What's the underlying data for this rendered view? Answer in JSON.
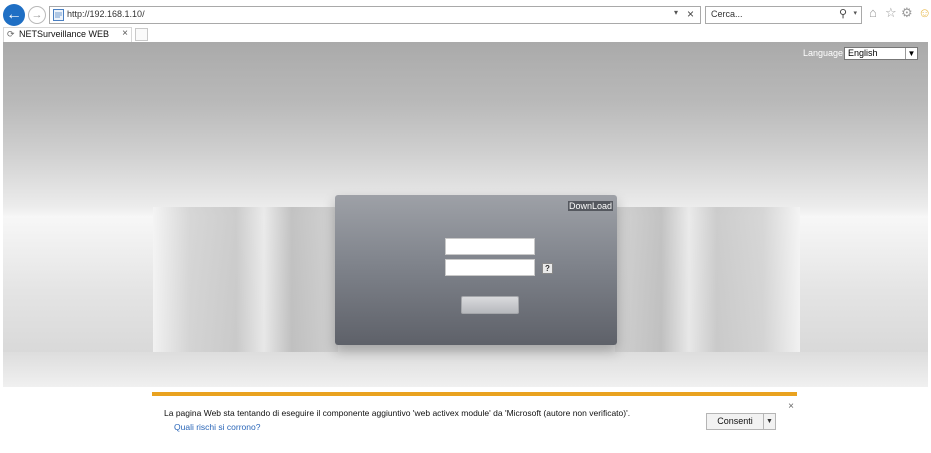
{
  "browser": {
    "address": "http://192.168.1.10/",
    "search_placeholder": "Cerca...",
    "icons": [
      "back-icon",
      "forward-icon",
      "page-icon",
      "dropdown-icon",
      "stop-icon",
      "search-icon",
      "home-icon",
      "favorites-icon",
      "settings-icon",
      "feedback-icon"
    ],
    "tab": {
      "title": "NETSurveillance WEB"
    }
  },
  "page": {
    "language_label": "Language",
    "language_value": "English",
    "download_label": "DownLoad",
    "help_label": "?"
  },
  "infobar": {
    "message": "La pagina Web sta tentando di eseguire il componente aggiuntivo 'web activex  module' da 'Microsoft (autore non verificato)'.",
    "link": "Quali rischi si corrono?",
    "allow_label": "Consenti",
    "accent": "#e9a21f"
  }
}
